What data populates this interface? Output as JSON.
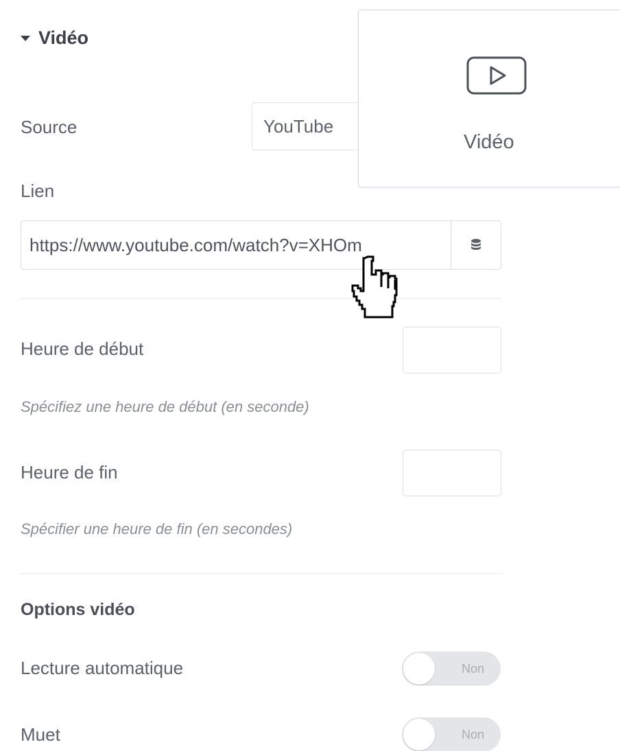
{
  "section": {
    "title": "Vidéo",
    "caret_icon": "caret-down-icon"
  },
  "source": {
    "label": "Source",
    "selected": "YouTube"
  },
  "link": {
    "label": "Lien",
    "value": "https://www.youtube.com/watch?v=XHOm",
    "dynamic_icon": "database-icon"
  },
  "start_time": {
    "label": "Heure de début",
    "value": "",
    "hint": "Spécifiez une heure de début (en seconde)"
  },
  "end_time": {
    "label": "Heure de fin",
    "value": "",
    "hint": "Spécifier une heure de fin (en secondes)"
  },
  "options": {
    "heading": "Options vidéo",
    "autoplay": {
      "label": "Lecture automatique",
      "state": "Non"
    },
    "mute": {
      "label": "Muet",
      "state": "Non"
    }
  },
  "widget": {
    "label": "Vidéo",
    "icon": "video-play-icon"
  },
  "cursor": {
    "icon": "hand-pointer-icon"
  },
  "colors": {
    "text": "#5c6068",
    "border": "#d9dbde",
    "toggle_off_bg": "#e3e5e8",
    "toggle_text": "#a9adb3",
    "hint": "#8a8e94"
  }
}
